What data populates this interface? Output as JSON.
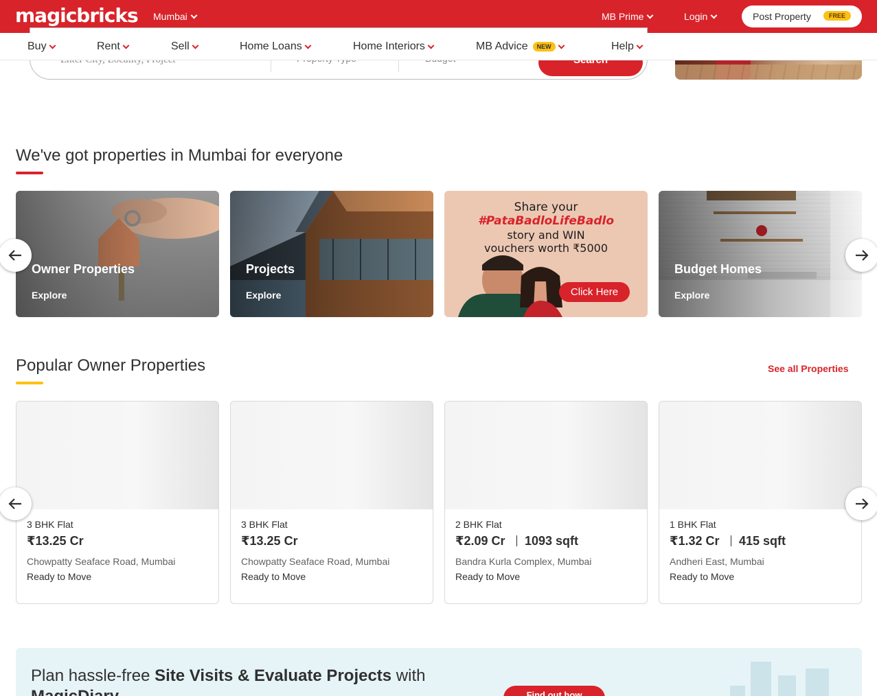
{
  "header": {
    "logo_text": "magicbricks",
    "city": "Mumbai",
    "mb_prime": "MB Prime",
    "login": "Login",
    "post_property": "Post Property",
    "post_property_badge": "FREE"
  },
  "nav": {
    "items": [
      {
        "label": "Buy"
      },
      {
        "label": "Rent"
      },
      {
        "label": "Sell"
      },
      {
        "label": "Home Loans"
      },
      {
        "label": "Home Interiors"
      },
      {
        "label": "MB Advice",
        "badge": "NEW"
      },
      {
        "label": "Help"
      }
    ]
  },
  "search": {
    "placeholder": "Enter City, Locality, Project",
    "property_type": "Property Type",
    "budget": "Budget",
    "button": "Search"
  },
  "section_everyone": {
    "title": "We've got properties in Mumbai for everyone",
    "cards": [
      {
        "title": "Owner Properties",
        "cta": "Explore"
      },
      {
        "title": "Projects",
        "cta": "Explore"
      },
      {
        "promo_line1": "Share  your",
        "promo_line2": "#PataBadloLifeBadlo",
        "promo_line3": "story and WIN",
        "promo_line4": "vouchers worth ₹5000",
        "button": "Click Here"
      },
      {
        "title": "Budget Homes",
        "cta": "Explore"
      }
    ]
  },
  "section_popular": {
    "title": "Popular Owner Properties",
    "see_all": "See all Properties",
    "properties": [
      {
        "type": "3 BHK Flat",
        "price": "₹13.25 Cr",
        "area": "",
        "location": "Chowpatty Seaface Road, Mumbai",
        "status": "Ready to Move"
      },
      {
        "type": "3 BHK Flat",
        "price": "₹13.25 Cr",
        "area": "",
        "location": "Chowpatty Seaface Road, Mumbai",
        "status": "Ready to Move"
      },
      {
        "type": "2 BHK Flat",
        "price": "₹2.09 Cr",
        "area": "1093 sqft",
        "location": "Bandra Kurla Complex, Mumbai",
        "status": "Ready to Move"
      },
      {
        "type": "1 BHK Flat",
        "price": "₹1.32 Cr",
        "area": "415 sqft",
        "location": "Andheri East, Mumbai",
        "status": "Ready to Move"
      }
    ]
  },
  "banner": {
    "text_prefix": "Plan hassle-free ",
    "text_bold": "Site Visits & Evaluate Projects",
    "text_mid": " with ",
    "text_brand": "MagicDiary",
    "button": "Find out how"
  },
  "icons": {
    "prev": "arrow-left-icon",
    "next": "arrow-right-icon"
  },
  "colors": {
    "brand_red": "#d8232a",
    "badge_yellow": "#fdc013"
  }
}
